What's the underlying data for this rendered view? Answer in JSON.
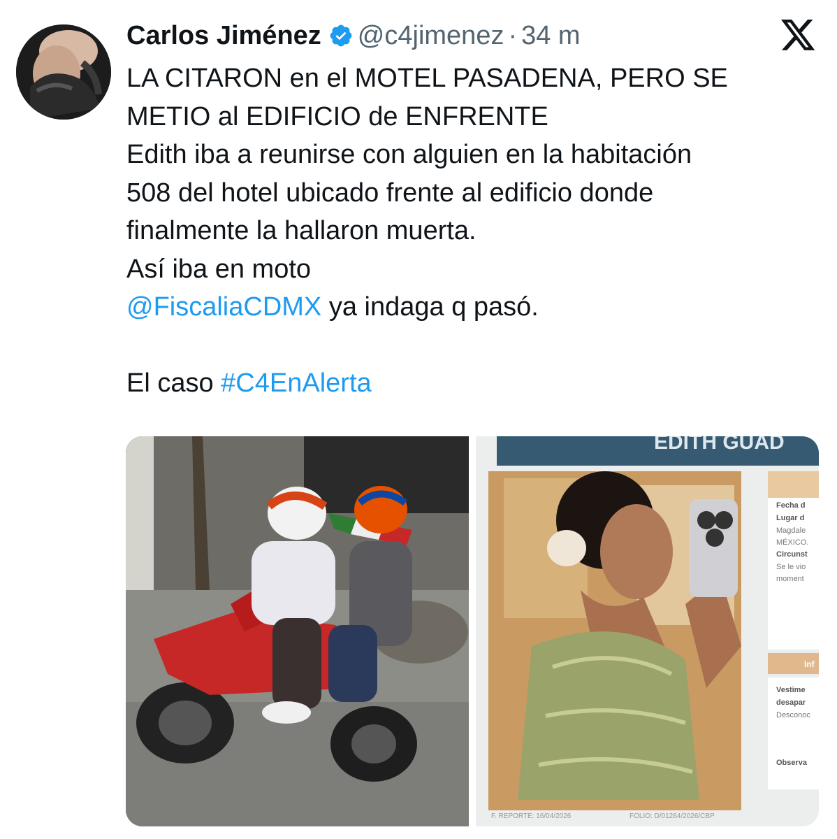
{
  "tweet": {
    "author_name": "Carlos Jiménez",
    "handle": "@c4jimenez",
    "separator": "·",
    "time": "34 m",
    "lines": {
      "l1": "LA CITARON en el MOTEL PASADENA, PERO SE",
      "l2": "METIO al EDIFICIO de ENFRENTE",
      "l3": "Edith iba a reunirse con alguien en la habitación",
      "l4": "508 del hotel ubicado frente al edificio donde",
      "l5": "finalmente la hallaron muerta.",
      "l6": "Así iba en moto",
      "mention": "@FiscaliaCDMX",
      "l7_rest": " ya indaga q pasó.",
      "l8_prefix": "El caso ",
      "hashtag": "#C4EnAlerta"
    }
  },
  "media": {
    "poster": {
      "header_text": "EDITH GUAD",
      "field_labels": [
        "Fecha d",
        "Lugar d",
        "Magdale",
        "MÉXICO.",
        "Circunst",
        "Se le vio",
        "moment",
        "Inf",
        "Vestime",
        "desapar",
        "Desconoc",
        "Observa"
      ],
      "footer_report": "F. REPORTE: 16/04/2026",
      "footer_folio": "FOLIO: D/01264/2026/CBP"
    }
  },
  "colors": {
    "text": "#0f1419",
    "secondary": "#536471",
    "link": "#1d9bf0",
    "verified": "#1d9bf0"
  },
  "icons": [
    "verified-badge-icon",
    "x-logo-icon"
  ]
}
